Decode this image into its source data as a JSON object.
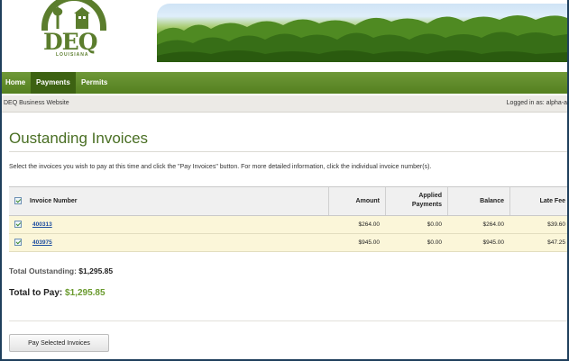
{
  "logo": {
    "text": "DEQ",
    "subtext": "LOUISIANA"
  },
  "nav": {
    "items": [
      "Home",
      "Payments",
      "Permits"
    ],
    "active": "Payments"
  },
  "subbar": {
    "left": "DEQ Business Website",
    "right": "Logged in as: alpha-a"
  },
  "page": {
    "title": "Oustanding Invoices",
    "instructions": "Select the invoices you wish to pay at this time and click the \"Pay Invoices\" button. For more detailed information, click the individual invoice number(s)."
  },
  "table": {
    "headers": {
      "invoice": "Invoice Number",
      "amount": "Amount",
      "applied1": "Applied",
      "applied2": "Payments",
      "balance": "Balance",
      "late_fee": "Late Fee"
    },
    "rows": [
      {
        "checked": true,
        "invoice": "400313",
        "amount": "$264.00",
        "applied": "$0.00",
        "balance": "$264.00",
        "late_fee": "$39.60"
      },
      {
        "checked": true,
        "invoice": "403975",
        "amount": "$945.00",
        "applied": "$0.00",
        "balance": "$945.00",
        "late_fee": "$47.25"
      }
    ]
  },
  "totals": {
    "outstanding_label": "Total Outstanding:",
    "outstanding_value": "$1,295.85",
    "topay_label": "Total to Pay:",
    "topay_value": "$1,295.85"
  },
  "button": {
    "label": "Pay Selected Invoices"
  },
  "colors": {
    "brand_green": "#5b7d2d",
    "nav_green": "#6e9838",
    "link_blue": "#1f4fa0",
    "row_highlight": "#fbf6d9"
  }
}
